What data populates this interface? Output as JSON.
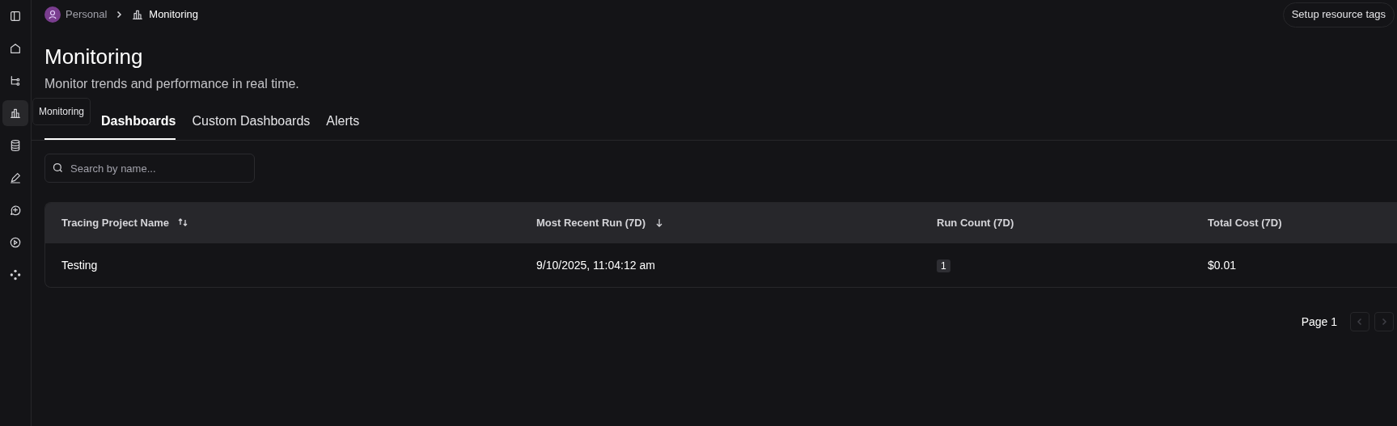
{
  "sidebar": {
    "items": [
      {
        "kind": "panel",
        "selected": false
      },
      {
        "kind": "home",
        "selected": false
      },
      {
        "kind": "flow",
        "selected": false
      },
      {
        "kind": "chart",
        "selected": true
      },
      {
        "kind": "database",
        "selected": false
      },
      {
        "kind": "pen",
        "selected": false
      },
      {
        "kind": "chat",
        "selected": false
      },
      {
        "kind": "play",
        "selected": false
      },
      {
        "kind": "nodes",
        "selected": false
      }
    ]
  },
  "tooltip": "Monitoring",
  "breadcrumb": [
    {
      "label": "Personal",
      "kind": "avatar"
    },
    {
      "label": "Monitoring",
      "kind": "chart"
    }
  ],
  "header_button": "Setup resource tags",
  "title": "Monitoring",
  "subtitle": "Monitor trends and performance in real time.",
  "tabs": [
    {
      "label": "Dashboards",
      "selected": true
    },
    {
      "label": "Custom Dashboards",
      "selected": false
    },
    {
      "label": "Alerts",
      "selected": false
    }
  ],
  "search": {
    "placeholder": "Search by name..."
  },
  "table": {
    "columns": [
      {
        "label": "Tracing Project Name",
        "kind": "sortable"
      },
      {
        "label": "Most Recent Run (7D)",
        "kind": "sorted"
      },
      {
        "label": "Run Count (7D)",
        "kind": "plain"
      },
      {
        "label": "Total Cost (7D)",
        "kind": "plain"
      }
    ],
    "rows": [
      [
        "Testing",
        "9/10/2025, 11:04:12 am",
        "1",
        "$0.01"
      ]
    ]
  },
  "pagination": {
    "label": "Page 1"
  }
}
